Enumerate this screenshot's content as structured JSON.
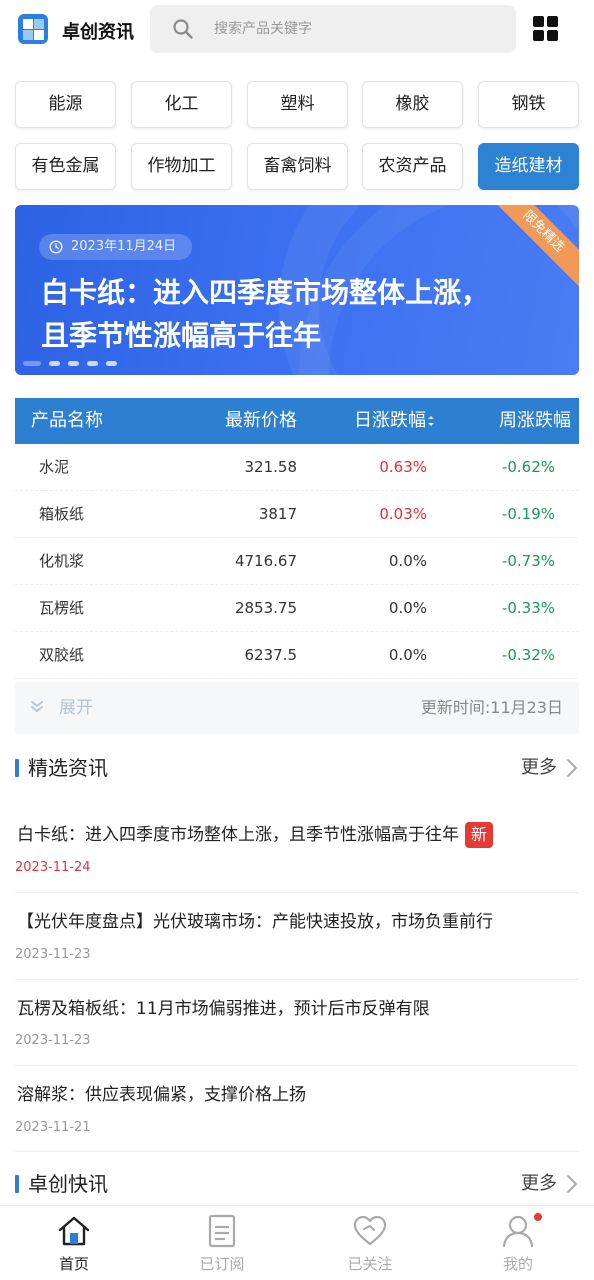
{
  "header": {
    "app_title": "卓创资讯",
    "search_placeholder": "搜索产品关键字"
  },
  "categories": [
    {
      "label": "能源",
      "active": false
    },
    {
      "label": "化工",
      "active": false
    },
    {
      "label": "塑料",
      "active": false
    },
    {
      "label": "橡胶",
      "active": false
    },
    {
      "label": "钢铁",
      "active": false
    },
    {
      "label": "有色金属",
      "active": false
    },
    {
      "label": "作物加工",
      "active": false
    },
    {
      "label": "畜禽饲料",
      "active": false
    },
    {
      "label": "农资产品",
      "active": false
    },
    {
      "label": "造纸建材",
      "active": true
    }
  ],
  "banner": {
    "date": "2023年11月24日",
    "title_line1": "白卡纸：进入四季度市场整体上涨，",
    "title_line2": "且季节性涨幅高于往年",
    "ribbon": "限免精选",
    "slide_count": 5,
    "active_slide": 1
  },
  "price_table": {
    "headers": {
      "name": "产品名称",
      "price": "最新价格",
      "day": "日涨跌幅",
      "week": "周涨跌幅"
    },
    "rows": [
      {
        "name": "水泥",
        "price": "321.58",
        "day": "0.63%",
        "day_trend": "up",
        "week": "-0.62%"
      },
      {
        "name": "箱板纸",
        "price": "3817",
        "day": "0.03%",
        "day_trend": "up",
        "week": "-0.19%"
      },
      {
        "name": "化机浆",
        "price": "4716.67",
        "day": "0.0%",
        "day_trend": "flat",
        "week": "-0.73%"
      },
      {
        "name": "瓦楞纸",
        "price": "2853.75",
        "day": "0.0%",
        "day_trend": "flat",
        "week": "-0.33%"
      },
      {
        "name": "双胶纸",
        "price": "6237.5",
        "day": "0.0%",
        "day_trend": "flat",
        "week": "-0.32%"
      }
    ],
    "expand_label": "展开",
    "update_time": "更新时间:11月23日"
  },
  "featured": {
    "title": "精选资讯",
    "more": "更多",
    "items": [
      {
        "title": "白卡纸：进入四季度市场整体上涨，且季节性涨幅高于往年",
        "date": "2023-11-24",
        "is_new": true,
        "new_label": "新"
      },
      {
        "title": "【光伏年度盘点】光伏玻璃市场：产能快速投放，市场负重前行",
        "date": "2023-11-23",
        "is_new": false
      },
      {
        "title": "瓦楞及箱板纸：11月市场偏弱推进，预计后市反弹有限",
        "date": "2023-11-23",
        "is_new": false
      },
      {
        "title": "溶解浆：供应表现偏紧，支撑价格上扬",
        "date": "2023-11-21",
        "is_new": false
      }
    ]
  },
  "flash": {
    "title": "卓创快讯",
    "more": "更多"
  },
  "bottom_nav": [
    {
      "label": "首页",
      "icon": "home-icon",
      "active": true
    },
    {
      "label": "已订阅",
      "icon": "document-icon",
      "active": false
    },
    {
      "label": "已关注",
      "icon": "heart-icon",
      "active": false
    },
    {
      "label": "我的",
      "icon": "user-icon",
      "active": false,
      "badge": true
    }
  ],
  "colors": {
    "accent": "#2d7fd1",
    "up": "#e03131",
    "down": "#1a9a52",
    "banner": "#3b6ff0",
    "ribbon": "#f29a55"
  }
}
